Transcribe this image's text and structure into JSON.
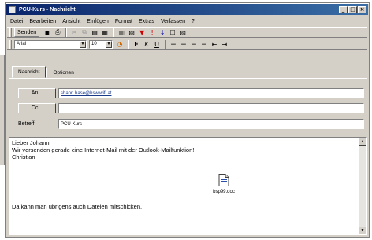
{
  "window": {
    "title": "PCU-Kurs - Nachricht"
  },
  "window_controls": {
    "minimize": "_",
    "maximize": "□",
    "close": "×"
  },
  "menu": [
    "Datei",
    "Bearbeiten",
    "Ansicht",
    "Einfügen",
    "Format",
    "Extras",
    "Verfassen",
    "?"
  ],
  "toolbar": {
    "send_label": "Senden"
  },
  "format": {
    "font": "Arial",
    "size": "10"
  },
  "tabs": [
    {
      "label": "Nachricht"
    },
    {
      "label": "Optionen"
    }
  ],
  "header": {
    "to_button": "An...",
    "to_value": "shann.hase@hsw.wifi.at",
    "cc_button": "Cc...",
    "cc_value": "",
    "subject_label": "Betreff:",
    "subject_value": "PCU-Kurs"
  },
  "body": {
    "lines": [
      "Lieber Johann!",
      "Wir versenden gerade eine Internet-Mail mit der Outlook-Mailfunktion!",
      "Christian",
      "Da kann man übrigens auch Dateien mitschicken."
    ],
    "attachment": {
      "name": "bsp99.doc",
      "icon": "document-icon"
    }
  },
  "colors": {
    "titlebar": "#0a246a",
    "panel": "#d4d0c8"
  }
}
